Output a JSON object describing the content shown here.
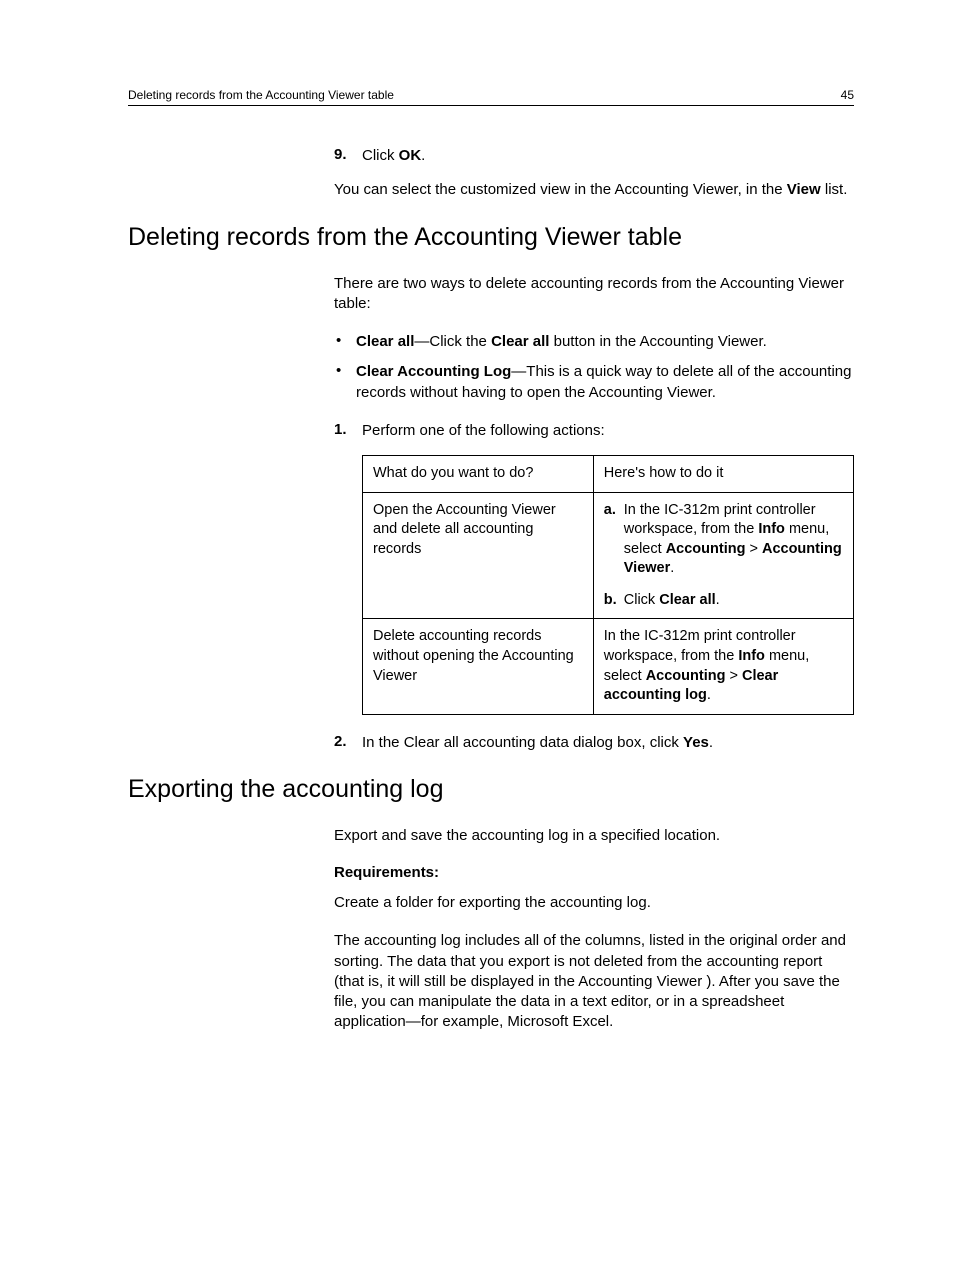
{
  "header": {
    "left": "Deleting records from the Accounting Viewer table",
    "right": "45"
  },
  "intro_step": {
    "num": "9.",
    "pre": "Click ",
    "bold": "OK",
    "post": "."
  },
  "intro_para": {
    "pre": "You can select the customized view in the Accounting Viewer, in the ",
    "bold": "View",
    "post": " list."
  },
  "section1": {
    "title": "Deleting records from the Accounting Viewer table",
    "lead": "There are two ways to delete accounting records from the Accounting Viewer table:",
    "bullets": [
      {
        "bold1": "Clear all",
        "mid": "—Click the ",
        "bold2": "Clear all",
        "post": " button in the Accounting Viewer."
      },
      {
        "bold1": "Clear Accounting Log",
        "post": "—This is a quick way to delete all of the accounting records without having to open the Accounting Viewer."
      }
    ],
    "step1": {
      "num": "1.",
      "text": "Perform one of the following actions:"
    },
    "table": {
      "h1": "What do you want to do?",
      "h2": "Here's how to do it",
      "r1c1": "Open the Accounting Viewer and delete all accounting records",
      "r1c2": {
        "a": {
          "marker": "a.",
          "pre": "In the IC-312m print controller workspace, from the ",
          "b1": "Info",
          "mid": " menu, select ",
          "b2": "Accounting",
          "gt": " > ",
          "b3": "Accounting Viewer",
          "post": "."
        },
        "b": {
          "marker": "b.",
          "pre": "Click ",
          "b1": "Clear all",
          "post": "."
        }
      },
      "r2c1": "Delete accounting records without opening the Accounting Viewer",
      "r2c2": {
        "pre": "In the IC-312m print controller workspace, from the ",
        "b1": "Info",
        "mid": " menu, select ",
        "b2": "Accounting",
        "gt": " > ",
        "b3": "Clear accounting log",
        "post": "."
      }
    },
    "step2": {
      "num": "2.",
      "pre": "In the Clear all accounting data dialog box, click ",
      "bold": "Yes",
      "post": "."
    }
  },
  "section2": {
    "title": "Exporting the accounting log",
    "lead": "Export and save the accounting log in a specified location.",
    "req_label": "Requirements:",
    "req_text": "Create a folder for exporting the accounting log.",
    "para": "The accounting log includes all of the columns, listed in the original order and sorting. The data that you export is not deleted from the accounting report (that is, it will still be displayed in the Accounting Viewer ). After you save the file, you can manipulate the data in a text editor, or in a spreadsheet application—for example, Microsoft Excel."
  }
}
